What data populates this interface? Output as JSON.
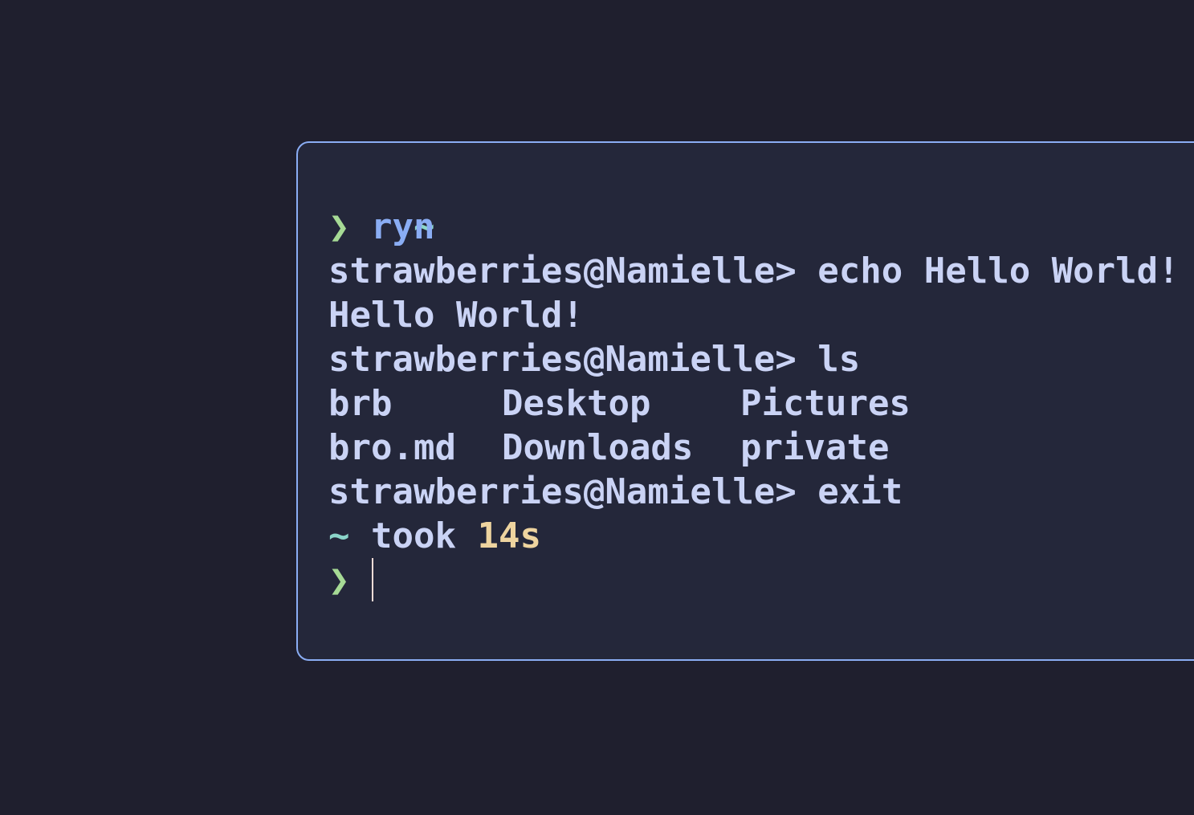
{
  "prompt": {
    "cwd": "~",
    "symbol": "❯"
  },
  "commands": {
    "first": "ryn",
    "shell_prompt": "strawberries@Namielle>",
    "echo_cmd": "echo Hello World!",
    "echo_output": "Hello World!",
    "ls_cmd": "ls",
    "ls_output": [
      [
        "brb",
        "Desktop",
        "Pictures"
      ],
      [
        "bro.md",
        "Downloads",
        "private"
      ]
    ],
    "exit_cmd": "exit"
  },
  "status": {
    "cwd": "~",
    "took_label": "took",
    "duration": "14s"
  },
  "colors": {
    "background": "#1f1f2e",
    "terminal_bg": "#24273a",
    "border": "#8aadf4",
    "text": "#cad3f5",
    "teal": "#8bd5ca",
    "green": "#a6da95",
    "blue": "#8aadf4",
    "yellow": "#eed49f"
  }
}
